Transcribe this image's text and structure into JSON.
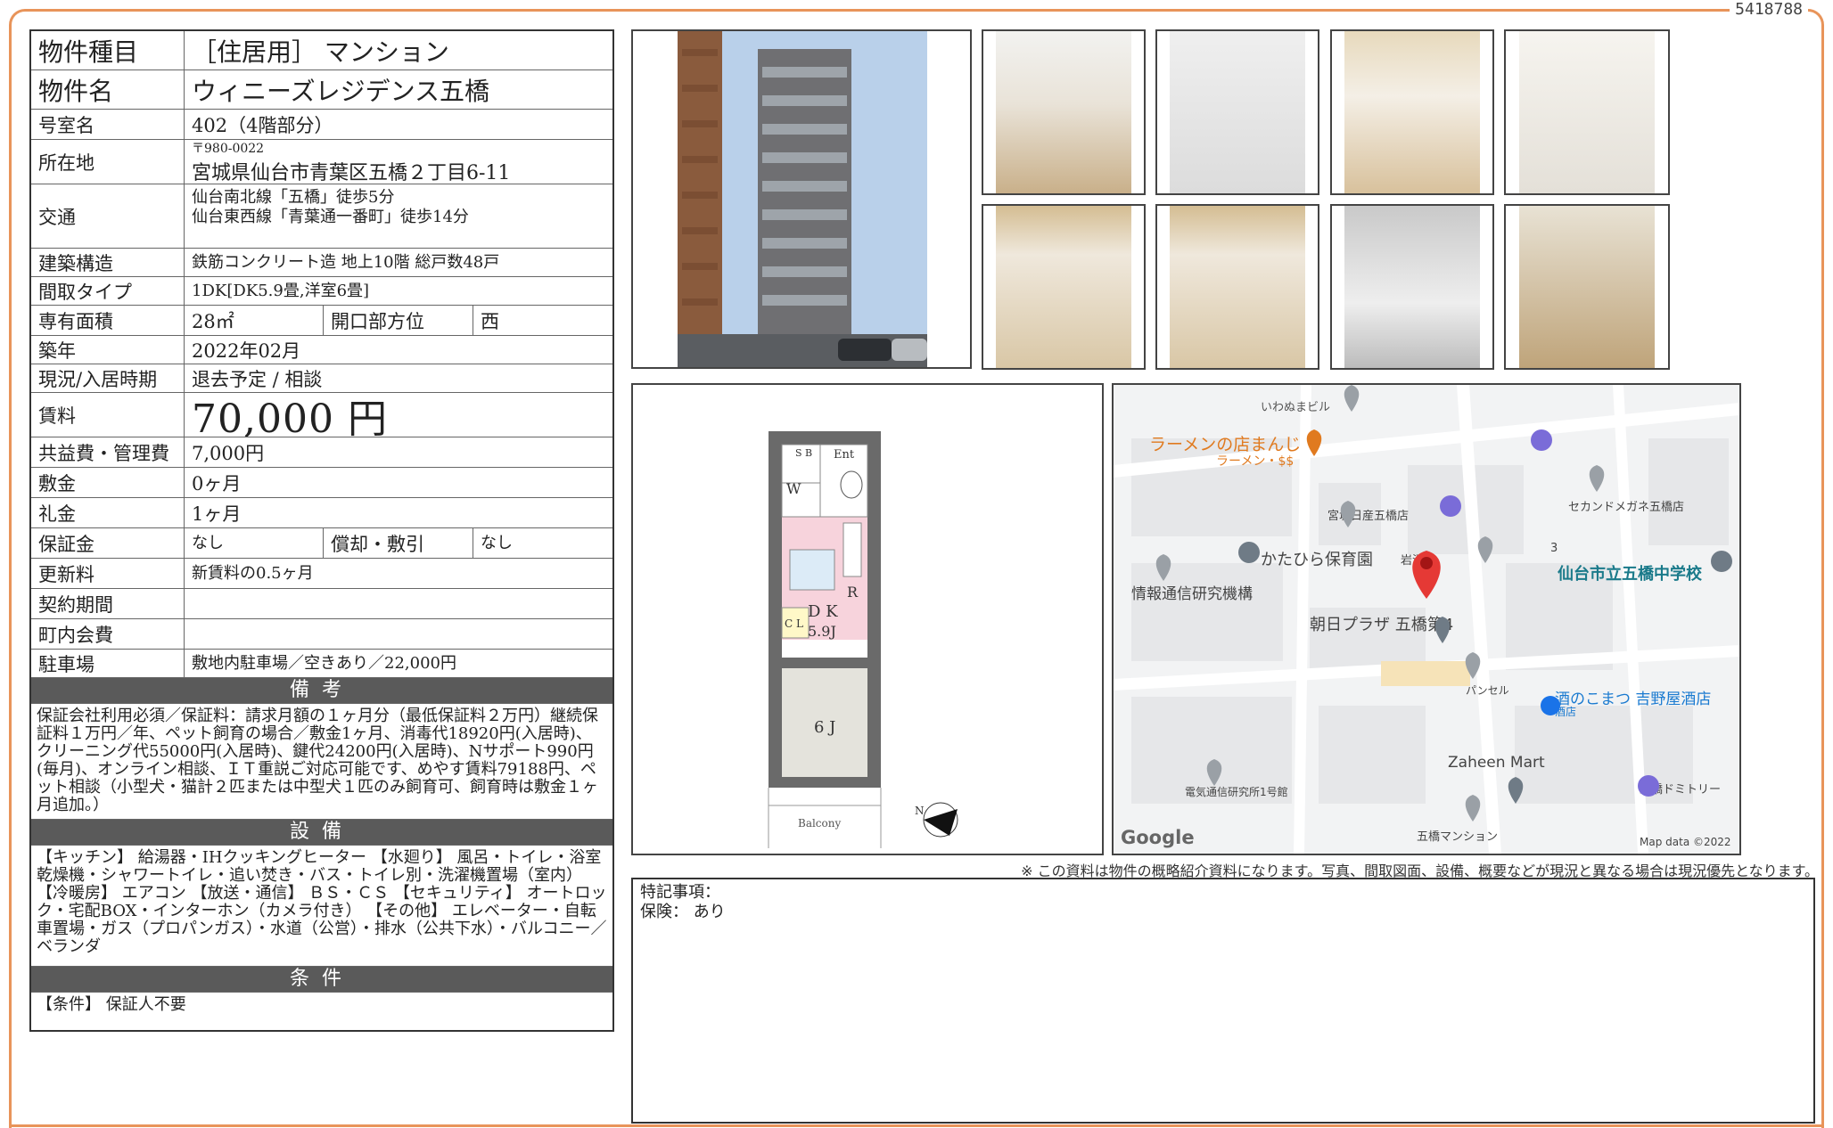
{
  "doc_id": "5418788",
  "spec": {
    "type_label": "物件種目",
    "type_value": "［住居用］ マンション",
    "name_label": "物件名",
    "name_value": "ウィニーズレジデンス五橋",
    "room_label": "号室名",
    "room_value": "402（4階部分）",
    "address_label": "所在地",
    "postal": "〒980-0022",
    "address": "宮城県仙台市青葉区五橋２丁目6-11",
    "traffic_label": "交通",
    "traffic_1": "仙台南北線「五橋」徒歩5分",
    "traffic_2": "仙台東西線「青葉通一番町」徒歩14分",
    "structure_label": "建築構造",
    "structure_value": "鉄筋コンクリート造 地上10階 総戸数48戸",
    "layout_label": "間取タイプ",
    "layout_value": "1DK[DK5.9畳,洋室6畳]",
    "area_label": "専有面積",
    "area_value": "28㎡",
    "direction_label": "開口部方位",
    "direction_value": "西",
    "built_label": "築年",
    "built_value": "2022年02月",
    "status_label": "現況/入居時期",
    "status_value": "退去予定 / 相談",
    "rent_label": "賃料",
    "rent_value": "70,000 円",
    "fee_label": "共益費・管理費",
    "fee_value": "7,000円",
    "deposit_label": "敷金",
    "deposit_value": "0ヶ月",
    "keymoney_label": "礼金",
    "keymoney_value": "1ヶ月",
    "guarantee_label": "保証金",
    "guarantee_value": "なし",
    "amort_label": "償却・敷引",
    "amort_value": "なし",
    "renewal_label": "更新料",
    "renewal_value": "新賃料の0.5ヶ月",
    "contract_label": "契約期間",
    "contract_value": "",
    "assoc_label": "町内会費",
    "assoc_value": "",
    "parking_label": "駐車場",
    "parking_value": "敷地内駐車場／空きあり／22,000円"
  },
  "notes": {
    "head": "備考",
    "text": "保証会社利用必須／保証料：請求月額の１ヶ月分（最低保証料２万円）継続保証料１万円／年、ペット飼育の場合／敷金1ヶ月、消毒代18920円(入居時)、クリーニング代55000円(入居時)、鍵代24200円(入居時)、Nサポート990円(毎月)、オンライン相談、ＩＴ重説ご対応可能です、めやす賃料79188円、ペット相談（小型犬・猫計２匹または中型犬１匹のみ飼育可、飼育時は敷金１ヶ月追加。）"
  },
  "equipment": {
    "head": "設備",
    "text": "【キッチン】 給湯器・IHクッキングヒーター 【水廻り】 風呂・トイレ・浴室乾燥機・シャワートイレ・追い焚き・バス・トイレ別・洗濯機置場（室内） 【冷暖房】 エアコン 【放送・通信】 ＢＳ・ＣＳ 【セキュリティ】 オートロック・宅配BOX・インターホン（カメラ付き） 【その他】 エレベーター・自転車置場・ガス（プロパンガス）・水道（公営）・排水（公共下水）・バルコニー／ベランダ"
  },
  "conditions": {
    "head": "条件",
    "text": "【条件】 保証人不要"
  },
  "floorplan": {
    "sb": "S B",
    "ent": "Ent",
    "w": "W",
    "cl": "C L",
    "r": "R",
    "dk": "D K",
    "dk_size": "5.9J",
    "room": "6 J",
    "balcony": "Balcony",
    "north": "N"
  },
  "map": {
    "labels": [
      "いわぬまビル",
      "ラーメンの店まんじ",
      "ラーメン・$$",
      "宮城日産五橋店",
      "セカンドメガネ五橋店",
      "かたひら保育園",
      "岩沼屋",
      "3",
      "仙台市立五橋中学校",
      "情報通信研究機構",
      "朝日プラザ 五橋第4",
      "パンセル",
      "酒のこまつ 吉野屋酒店",
      "酒店",
      "Zaheen Mart",
      "電気通信研究所1号館",
      "五橋ドミトリー",
      "五橋マンション",
      "Google",
      "Map data ©2022"
    ]
  },
  "disclaimer": "※ この資料は物件の概略紹介資料になります。写真、間取図面、設備、概要などが現況と異なる場合は現況優先となります。",
  "remarks": {
    "line1": "特記事項：",
    "line2": "保険： あり"
  }
}
